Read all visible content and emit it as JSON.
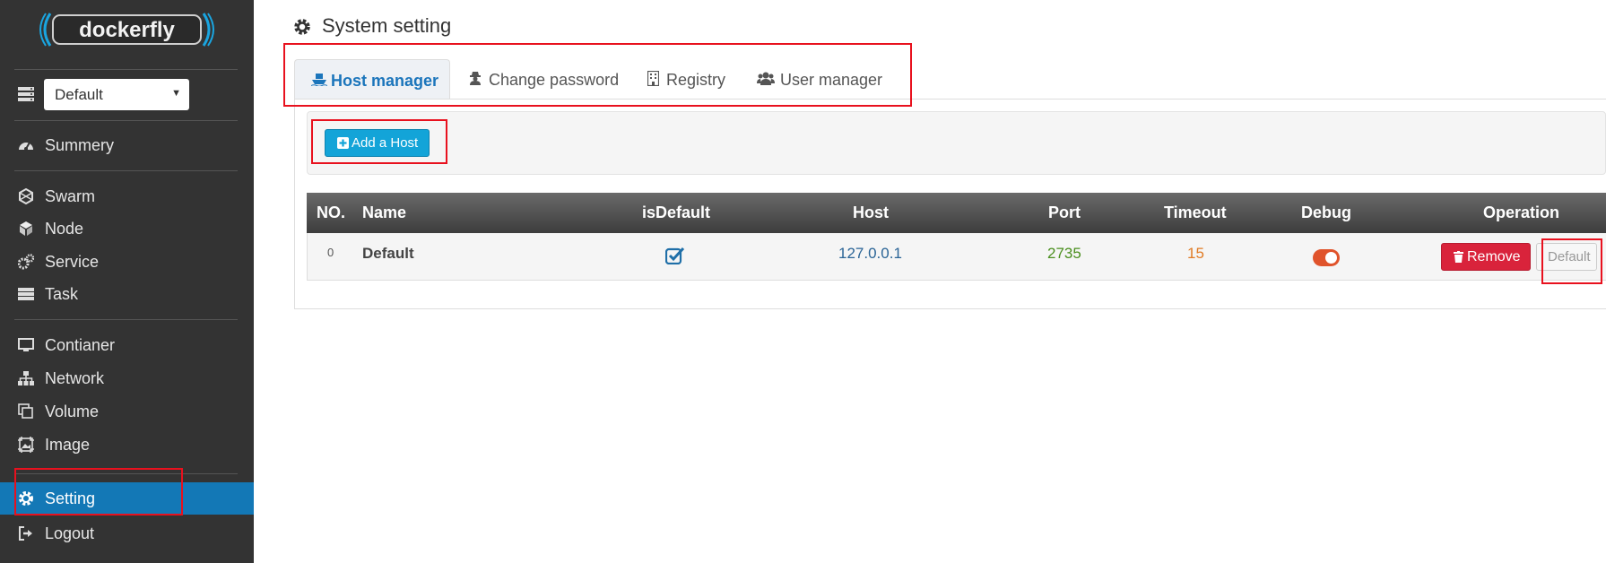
{
  "app": {
    "logo_text": "dockerfly"
  },
  "sidebar": {
    "host_select": {
      "value": "Default"
    },
    "items": [
      {
        "label": "Summery",
        "icon": "dashboard-icon"
      },
      {
        "label": "Swarm",
        "icon": "swarm-icon"
      },
      {
        "label": "Node",
        "icon": "cube-icon"
      },
      {
        "label": "Service",
        "icon": "cogs-icon"
      },
      {
        "label": "Task",
        "icon": "server-icon"
      },
      {
        "label": "Contianer",
        "icon": "monitor-icon"
      },
      {
        "label": "Network",
        "icon": "sitemap-icon"
      },
      {
        "label": "Volume",
        "icon": "copy-icon"
      },
      {
        "label": "Image",
        "icon": "image-frame-icon"
      },
      {
        "label": "Setting",
        "icon": "gear-icon",
        "active": true
      },
      {
        "label": "Logout",
        "icon": "sign-out-icon"
      }
    ]
  },
  "page": {
    "title": "System setting"
  },
  "tabs": [
    {
      "label": "Host manager",
      "icon": "ship-icon",
      "active": true
    },
    {
      "label": "Change password",
      "icon": "user-secret-icon"
    },
    {
      "label": "Registry",
      "icon": "building-icon"
    },
    {
      "label": "User manager",
      "icon": "users-icon"
    }
  ],
  "toolbar": {
    "add_host_label": "Add a Host"
  },
  "table": {
    "headers": [
      "NO.",
      "Name",
      "isDefault",
      "Host",
      "Port",
      "Timeout",
      "Debug",
      "Operation"
    ],
    "rows": [
      {
        "no": "0",
        "name": "Default",
        "is_default": true,
        "host": "127.0.0.1",
        "port": "2735",
        "timeout": "15",
        "debug": true,
        "remove_label": "Remove",
        "default_label": "Default"
      }
    ]
  },
  "colors": {
    "sidebar_bg": "#333333",
    "active_blue": "#1378b6",
    "tab_active_text": "#1b75bb",
    "add_button": "#13a4d8",
    "remove_button": "#d9233b",
    "port_text": "#4a8f1e",
    "timeout_text": "#e07b25",
    "host_text": "#2a6496",
    "toggle_on": "#e0532b",
    "highlight_box": "#e8111e"
  }
}
